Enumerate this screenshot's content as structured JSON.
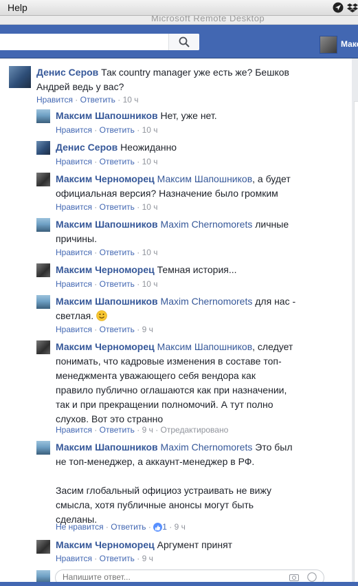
{
  "menubar": {
    "help_label": "Help"
  },
  "window": {
    "title": "Microsoft Remote Desktop"
  },
  "fb_header": {
    "search_placeholder": "",
    "profile_name": "Макс"
  },
  "comments": [
    {
      "author": "Денис Серов",
      "text_lines": [
        " Так country manager уже есть же? Бешков",
        "Андрей ведь у вас?"
      ],
      "like_label": "Нравится",
      "reply_label": "Ответить",
      "time": "10 ч"
    },
    {
      "author": "Максим Шапошников",
      "text_lines": [
        " Нет, уже нет."
      ],
      "like_label": "Нравится",
      "reply_label": "Ответить",
      "time": "10 ч"
    },
    {
      "author": "Денис Серов",
      "text_lines": [
        " Неожиданно"
      ],
      "like_label": "Нравится",
      "reply_label": "Ответить",
      "time": "10 ч"
    },
    {
      "author": "Максим Черноморец",
      "mention": "Максим Шапошников",
      "text_lines": [
        ", а будет",
        "официальная версия? Назначение было громким"
      ],
      "like_label": "Нравится",
      "reply_label": "Ответить",
      "time": "10 ч"
    },
    {
      "author": "Максим Шапошников",
      "mention": "Maxim Chernomorets",
      "text_lines": [
        " личные",
        "причины."
      ],
      "like_label": "Нравится",
      "reply_label": "Ответить",
      "time": "10 ч"
    },
    {
      "author": "Максим Черноморец",
      "text_lines": [
        " Темная история..."
      ],
      "like_label": "Нравится",
      "reply_label": "Ответить",
      "time": "10 ч"
    },
    {
      "author": "Максим Шапошников",
      "mention": "Maxim Chernomorets",
      "text_lines": [
        " для нас -",
        "светлая."
      ],
      "like_label": "Нравится",
      "reply_label": "Ответить",
      "time": "9 ч"
    },
    {
      "author": "Максим Черноморец",
      "mention": "Максим Шапошников",
      "text_lines": [
        ", следует",
        "понимать, что кадровые изменения в составе топ-",
        "менеджмента уважающего себя вендора как",
        "правило публично оглашаются как при назначении,",
        "так и при прекращении полномочий. А тут полно",
        "слухов. Вот это странно"
      ],
      "like_label": "Нравится",
      "reply_label": "Ответить",
      "time": "9 ч",
      "edited": "Отредактировано"
    },
    {
      "author": "Максим Шапошников",
      "mention": "Maxim Chernomorets",
      "text_lines": [
        " Это был",
        "не топ-менеджер, а аккаунт-менеджер в РФ.",
        "",
        "Засим глобальный официоз устраивать не вижу",
        "смысла, хотя публичные анонсы могут быть",
        "сделаны."
      ],
      "like_label": "Не нравится",
      "reply_label": "Ответить",
      "likes": "1",
      "time": "9 ч"
    },
    {
      "author": "Максим Черноморец",
      "text_lines": [
        " Аргумент принят"
      ],
      "like_label": "Нравится",
      "reply_label": "Ответить",
      "time": "9 ч"
    }
  ],
  "reply_box": {
    "placeholder": "Напишите ответ..."
  },
  "icons": [
    "help-menu",
    "location-arrow-icon",
    "dropbox-icon",
    "search-icon",
    "like-icon",
    "smiley-icon",
    "camera-icon",
    "emoji-icon"
  ],
  "colors": {
    "fb_blue": "#4267b2",
    "link": "#365899",
    "meta": "#90949c",
    "text": "#1d2129"
  }
}
